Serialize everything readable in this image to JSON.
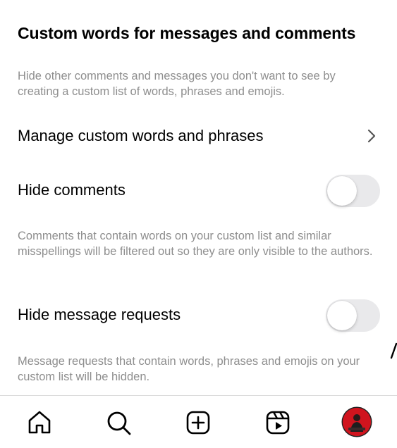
{
  "section": {
    "title": "Custom words for messages and comments",
    "description": "Hide other comments and messages you don't want to see by creating a custom list of words, phrases and emojis."
  },
  "manage_row": {
    "label": "Manage custom words and phrases",
    "icon": "chevron-right-icon"
  },
  "hide_comments": {
    "label": "Hide comments",
    "enabled": false,
    "description": "Comments that contain words on your custom list and similar misspellings will be filtered out so they are only visible to the authors."
  },
  "hide_message_requests": {
    "label": "Hide message requests",
    "enabled": false,
    "description": "Message requests that contain words, phrases and emojis on your custom list will be hidden."
  },
  "nav": {
    "items": [
      "home-icon",
      "search-icon",
      "create-icon",
      "reels-icon",
      "profile-avatar"
    ]
  },
  "colors": {
    "toggle_off": "#e9e9eb",
    "secondary_text": "#8e8e8e",
    "avatar_bg": "#d0141e"
  }
}
